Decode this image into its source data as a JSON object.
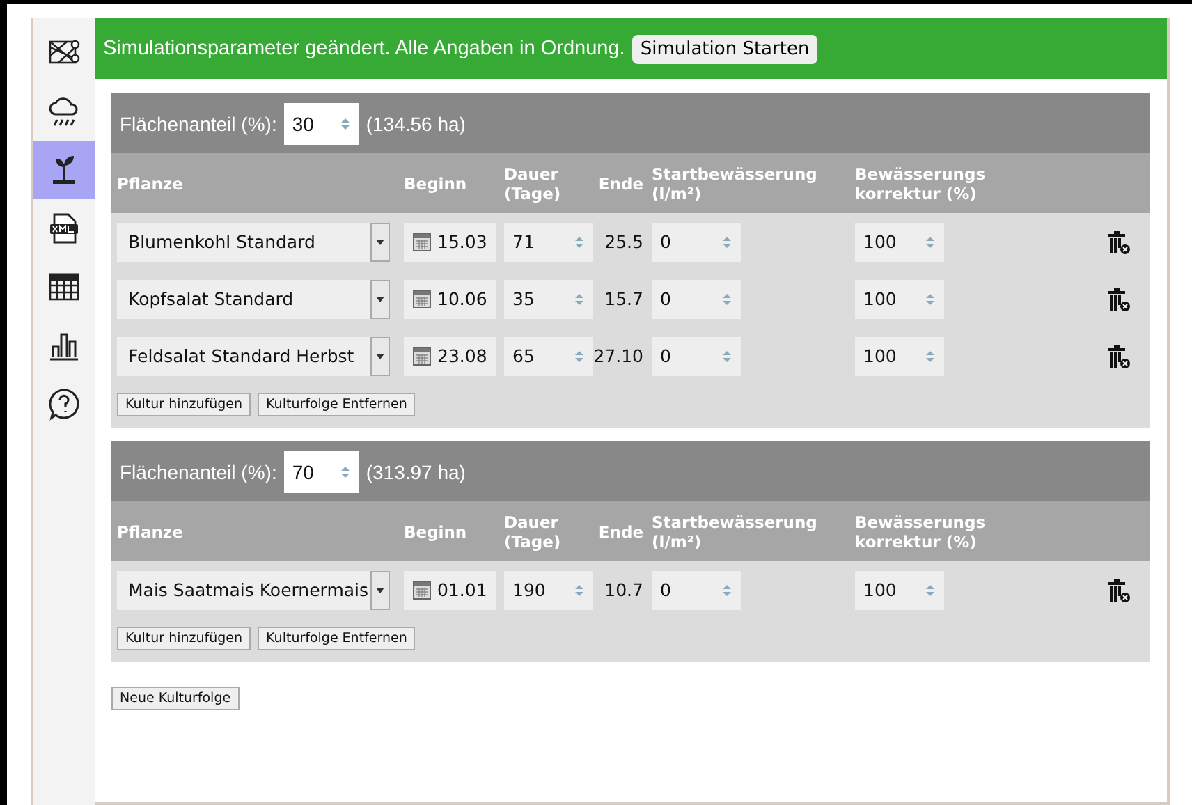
{
  "sidebar": {
    "items": [
      {
        "selected": false
      },
      {
        "selected": false
      },
      {
        "selected": true
      },
      {
        "selected": false
      },
      {
        "selected": false
      },
      {
        "selected": false
      },
      {
        "selected": false
      }
    ]
  },
  "banner": {
    "message": "Simulationsparameter geändert. Alle Angaben in Ordnung.",
    "button": "Simulation Starten"
  },
  "crop_sequences": [
    {
      "share_label": "Flächenanteil (%):",
      "share": "30",
      "area": "(134.56 ha)",
      "columns": [
        "Pflanze",
        "Beginn",
        "Dauer (Tage)",
        "Ende",
        "Startbewässerung (l/m²)",
        "Bewässerungs korrektur (%)"
      ],
      "rows": [
        {
          "plant": "Blumenkohl Standard",
          "start": "15.03",
          "duration": "71",
          "end": "25.5",
          "irrigation": "0",
          "correction": "100"
        },
        {
          "plant": "Kopfsalat Standard",
          "start": "10.06",
          "duration": "35",
          "end": "15.7",
          "irrigation": "0",
          "correction": "100"
        },
        {
          "plant": "Feldsalat Standard Herbst",
          "start": "23.08",
          "duration": "65",
          "end": "27.10",
          "irrigation": "0",
          "correction": "100"
        }
      ],
      "buttons": [
        "Kultur hinzufügen",
        "Kulturfolge Entfernen"
      ]
    },
    {
      "share_label": "Flächenanteil (%):",
      "share": "70",
      "area": "(313.97 ha)",
      "columns": [
        "Pflanze",
        "Beginn",
        "Dauer (Tage)",
        "Ende",
        "Startbewässerung (l/m²)",
        "Bewässerungs korrektur (%)"
      ],
      "rows": [
        {
          "plant": "Mais Saatmais Koernermais",
          "start": "01.01",
          "duration": "190",
          "end": "10.7",
          "irrigation": "0",
          "correction": "100"
        }
      ],
      "buttons": [
        "Kultur hinzufügen",
        "Kulturfolge Entfernen"
      ]
    }
  ],
  "new_sequence_button": "Neue Kulturfolge"
}
